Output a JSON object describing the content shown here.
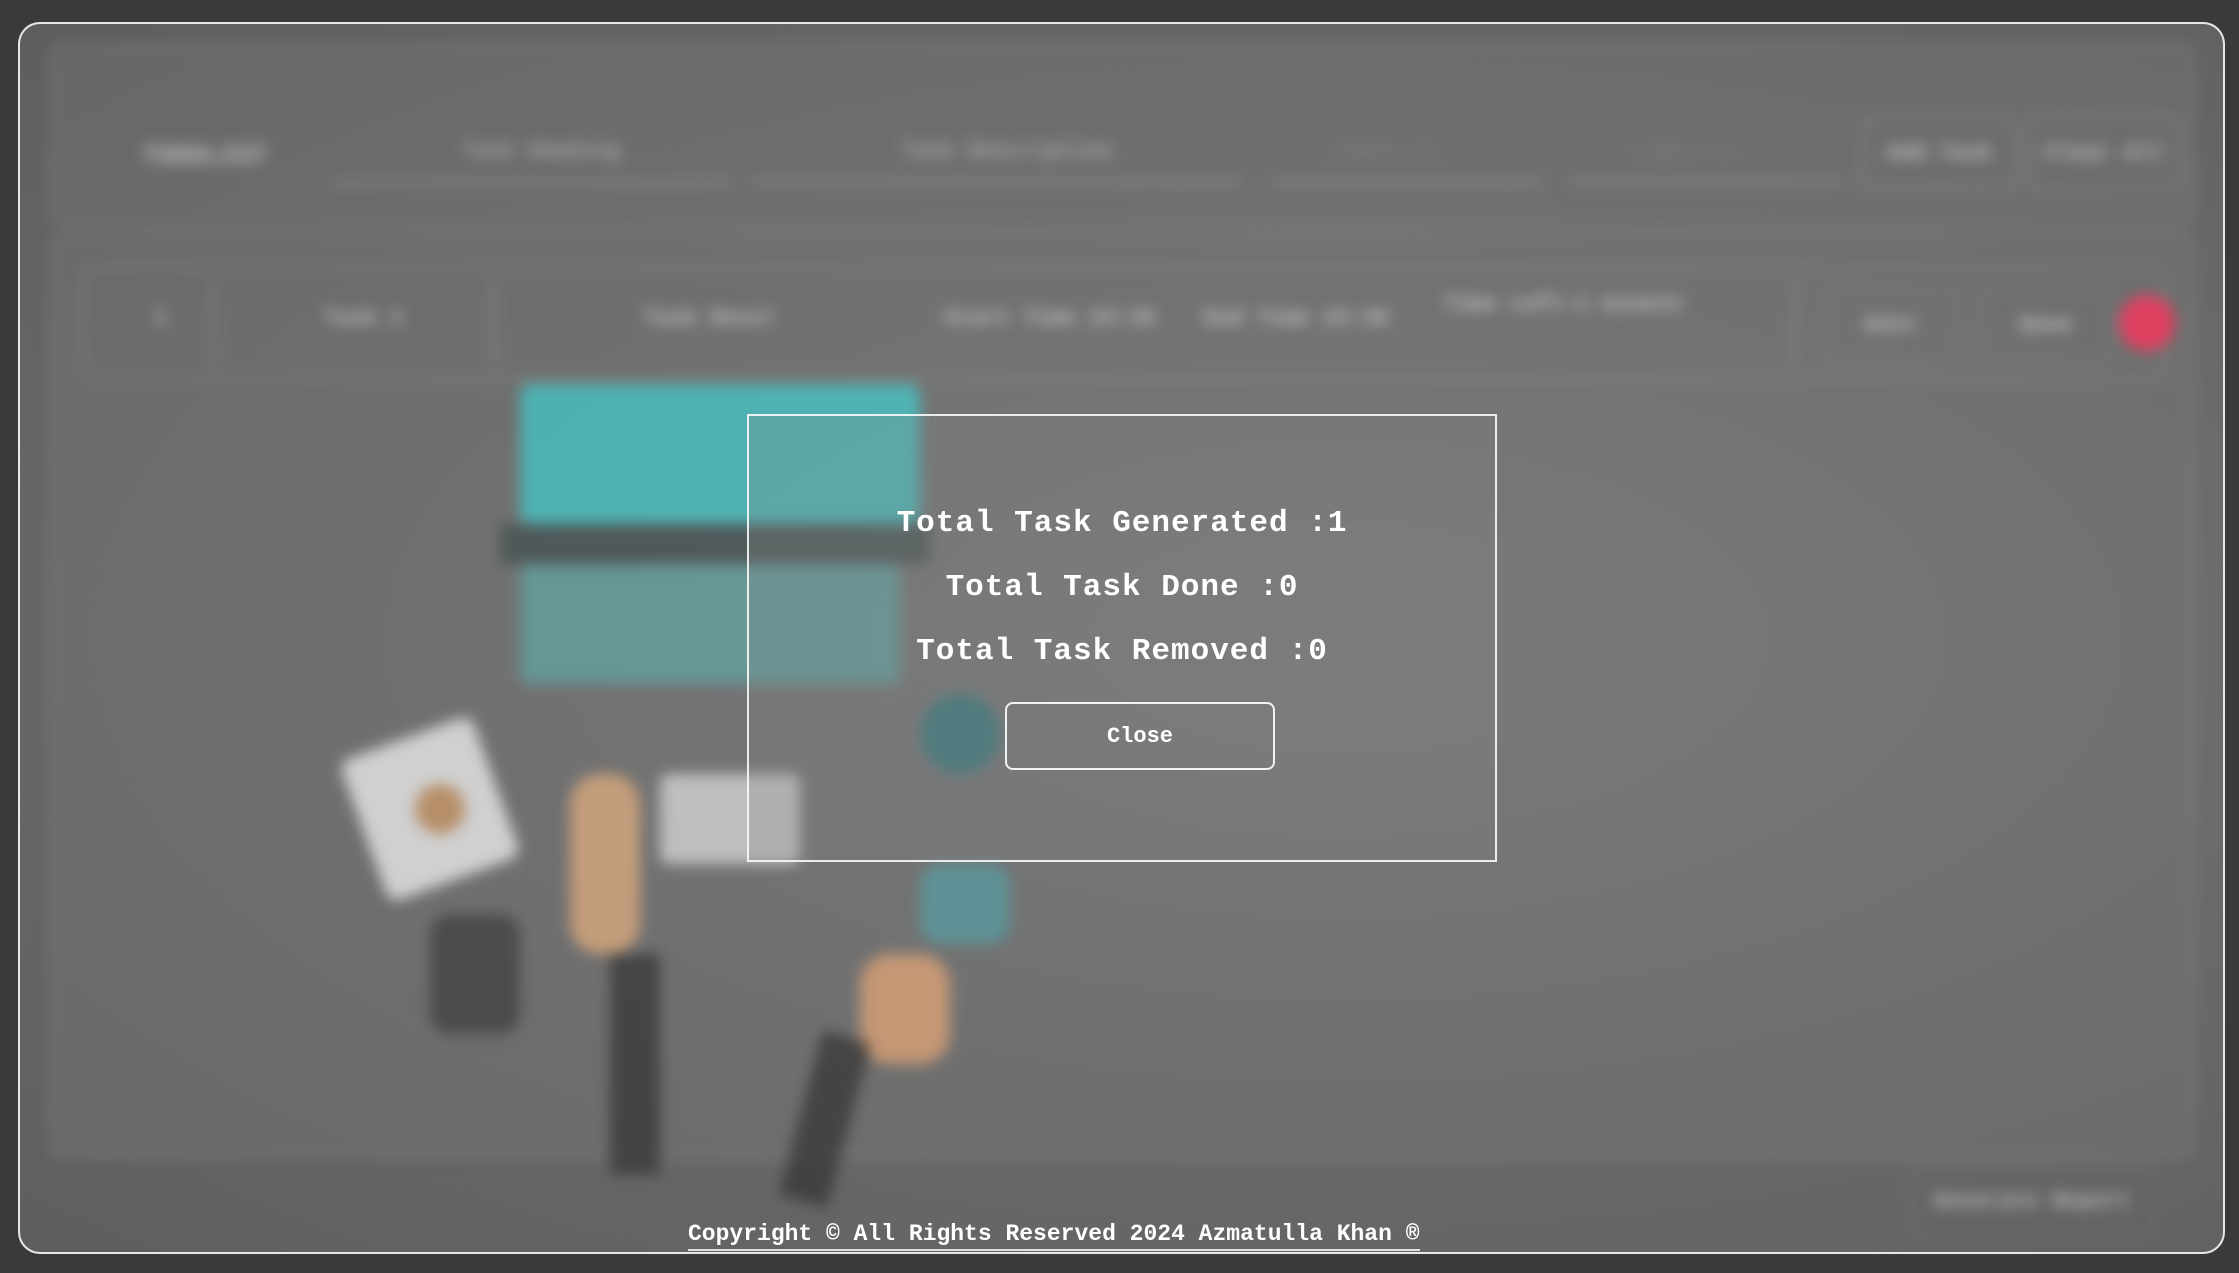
{
  "modal": {
    "total_generated": "Total Task Generated :1",
    "total_done": "Total Task Done :0",
    "total_removed": "Total Task Removed :0",
    "close_label": "Close"
  },
  "footer": {
    "copyright": "Copyright © All Rights Reserved 2024 Azmatulla Khan ®"
  },
  "background": {
    "app_name": "TODOLIST",
    "task_heading_placeholder": "Task Heading",
    "task_description_placeholder": "Task Description",
    "start_time_placeholder": "--:-- --",
    "end_time_placeholder": "--:-- --",
    "add_task_label": "Add Task",
    "clear_all_label": "Clear All",
    "generate_report_label": "Generate Report",
    "task_row": {
      "index": "1",
      "heading": "Task 1",
      "description": "Task Descr",
      "start_time": "Start Time 23:35",
      "end_time": "End Time 23:36",
      "time_left": "Time Left:1 minute",
      "edit_label": "Edit",
      "done_label": "Done"
    }
  },
  "colors": {
    "accent_red": "#e04060",
    "illustration_cyan": "#3dd6d6",
    "modal_border": "#ffffff"
  }
}
